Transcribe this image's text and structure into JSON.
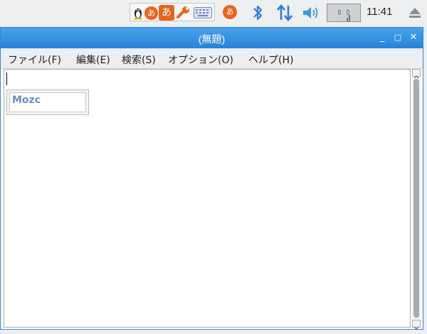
{
  "taskbar": {
    "ime_panel": {
      "circle_glyph": "あ",
      "square_glyph": "あ"
    },
    "tray_ime_glyph": "あ",
    "cpu_label": "▯ ▯",
    "clock": "11:41"
  },
  "window": {
    "title": "(無題)",
    "controls": {
      "minimize": "_",
      "maximize": "□",
      "close": "✕"
    }
  },
  "menu": {
    "items": [
      {
        "label": "ファイル(F)"
      },
      {
        "label": "編集(E)"
      },
      {
        "label": "検索(S)"
      },
      {
        "label": "オプション(O)"
      },
      {
        "label": "ヘルプ(H)"
      }
    ]
  },
  "ime_candidate": {
    "label": "Mozc"
  },
  "colors": {
    "accent": "#2f86d6",
    "ime_orange": "#e8641b",
    "mozc_text": "#6b8fc4"
  }
}
